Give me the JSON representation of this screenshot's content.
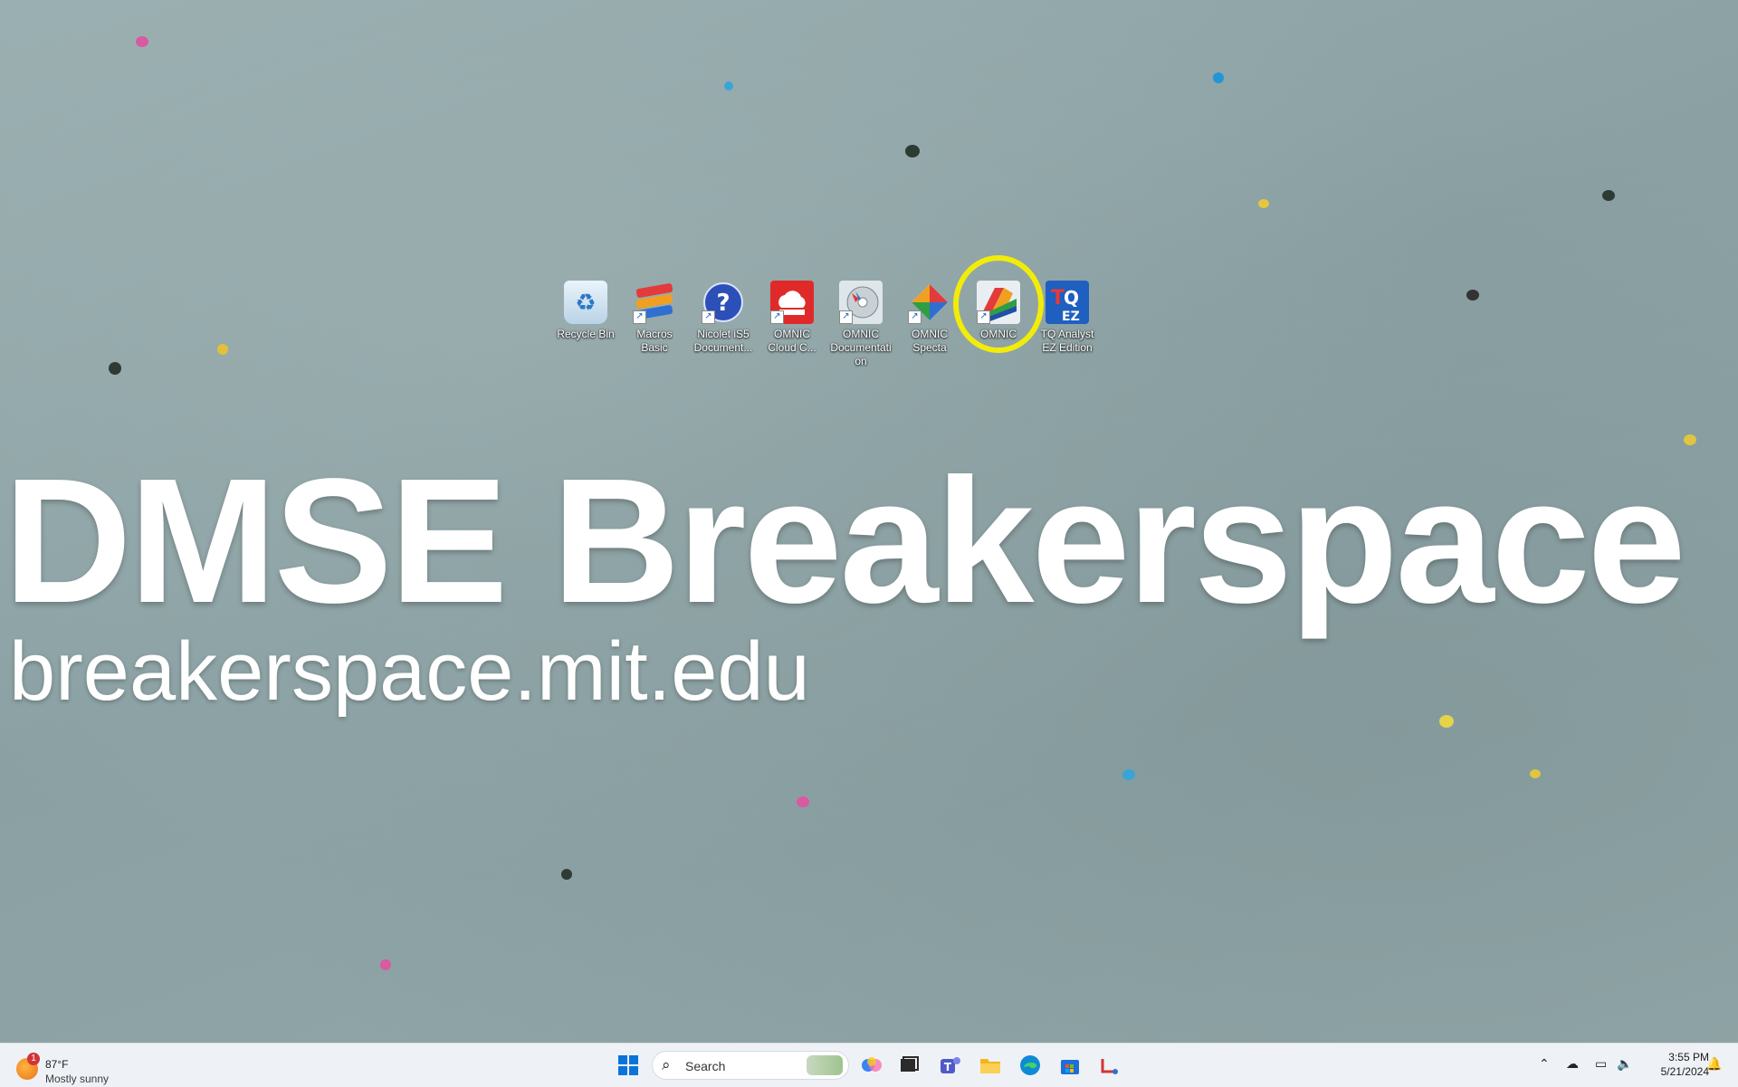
{
  "desktop": {
    "icons": [
      {
        "label": "Recycle Bin",
        "icon": "recycle-bin-icon"
      },
      {
        "label": "Macros Basic",
        "icon": "macros-basic-icon"
      },
      {
        "label": "Nicolet iS5 Document...",
        "icon": "help-question-icon"
      },
      {
        "label": "OMNIC Cloud C...",
        "icon": "omnic-cloud-icon"
      },
      {
        "label": "OMNIC Documentati on",
        "icon": "omnic-documentation-icon"
      },
      {
        "label": "OMNIC Specta",
        "icon": "omnic-specta-icon"
      },
      {
        "label": "OMNIC",
        "icon": "omnic-icon"
      },
      {
        "label": "TQ Analyst EZ Edition",
        "icon": "tq-analyst-icon"
      }
    ],
    "wallpaper_title": "DMSE Breakerspace",
    "wallpaper_subtitle": "breakerspace.mit.edu"
  },
  "taskbar": {
    "weather": {
      "badge": "1",
      "temp": "87°F",
      "condition": "Mostly sunny"
    },
    "search_placeholder": "Search",
    "apps": [
      "copilot-icon",
      "task-view-icon",
      "teams-icon",
      "file-explorer-icon",
      "edge-icon",
      "store-icon",
      "snipping-tool-icon"
    ],
    "clock": {
      "time": "3:55 PM",
      "date": "5/21/2024"
    }
  },
  "colors": {
    "highlight": "#f2ec0a",
    "taskbar": "#eef2f6"
  }
}
